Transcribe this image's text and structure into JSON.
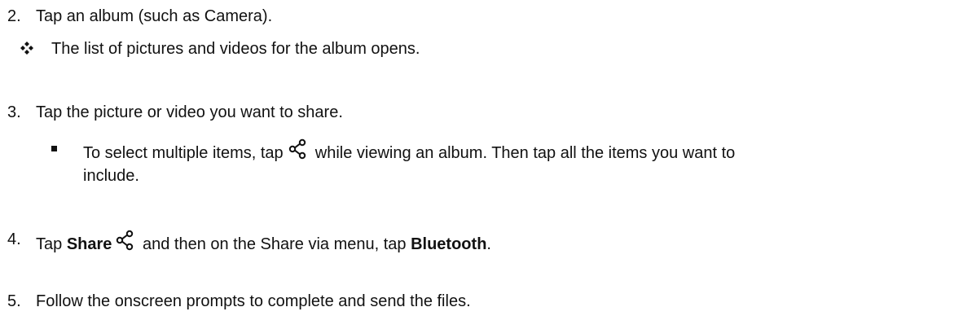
{
  "steps": {
    "s2": {
      "number": "2.",
      "text": "Tap an album (such as Camera)."
    },
    "s2_result": {
      "text": "The list of pictures and videos for the album opens."
    },
    "s3": {
      "number": "3.",
      "text": "Tap the picture or video you want to share."
    },
    "s3_note": {
      "before_icon": "To select multiple items, tap",
      "after_icon": "while viewing an album. Then tap all the items you want to",
      "continuation": "include."
    },
    "s4": {
      "number": "4.",
      "before": "Tap ",
      "share_bold": "Share",
      "middle": "and then on the Share via menu, tap ",
      "bluetooth_bold": "Bluetooth",
      "end": "."
    },
    "s5": {
      "number": "5.",
      "text": "Follow the onscreen prompts to complete and send the files."
    }
  },
  "icons": {
    "result_bullet": "four-diamond-bullet-icon",
    "note_bullet": "square-bullet-icon",
    "share": "share-icon"
  },
  "colors": {
    "text": "#111111",
    "background": "#ffffff"
  }
}
